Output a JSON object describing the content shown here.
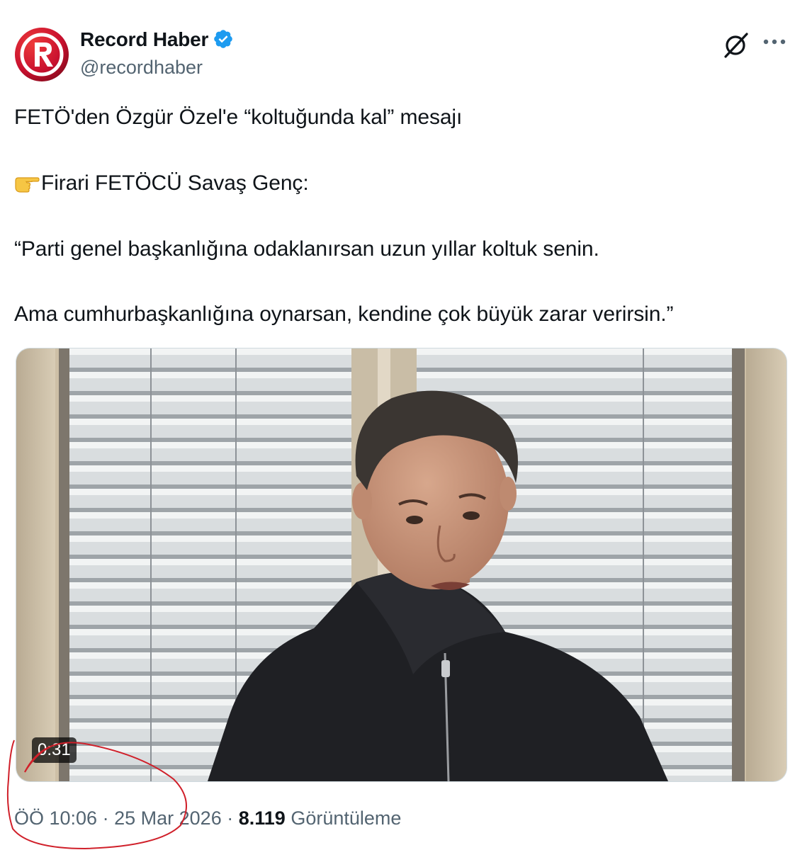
{
  "header": {
    "display_name": "Record Haber",
    "handle": "@recordhaber",
    "avatar_icon": "record-haber-logo",
    "verified_icon": "verified-badge-icon",
    "grok_icon": "grok-icon",
    "more_icon": "more-options-icon",
    "verified_color": "#1d9bf0",
    "brand_color": "#c8102e"
  },
  "tweet": {
    "line1": "FETÖ'den Özgür Özel'e “koltuğunda kal” mesajı",
    "line2_emoji": "backhand-index-pointing-right-emoji",
    "line2": "Firari FETÖCÜ Savaş Genç:",
    "line3": "“Parti genel başkanlığına odaklanırsan uzun yıllar koltuk senin.",
    "line4": "Ama cumhurbaşkanlığına oynarsan, kendine çok büyük zarar verirsin.”"
  },
  "media": {
    "type": "video",
    "duration": "0:31"
  },
  "meta": {
    "time": "ÖÖ 10:06",
    "separator": "·",
    "date": "25 Mar 2026",
    "views_count": "8.119",
    "views_label": "Görüntüleme"
  },
  "annotation": {
    "color": "#d0202a"
  }
}
